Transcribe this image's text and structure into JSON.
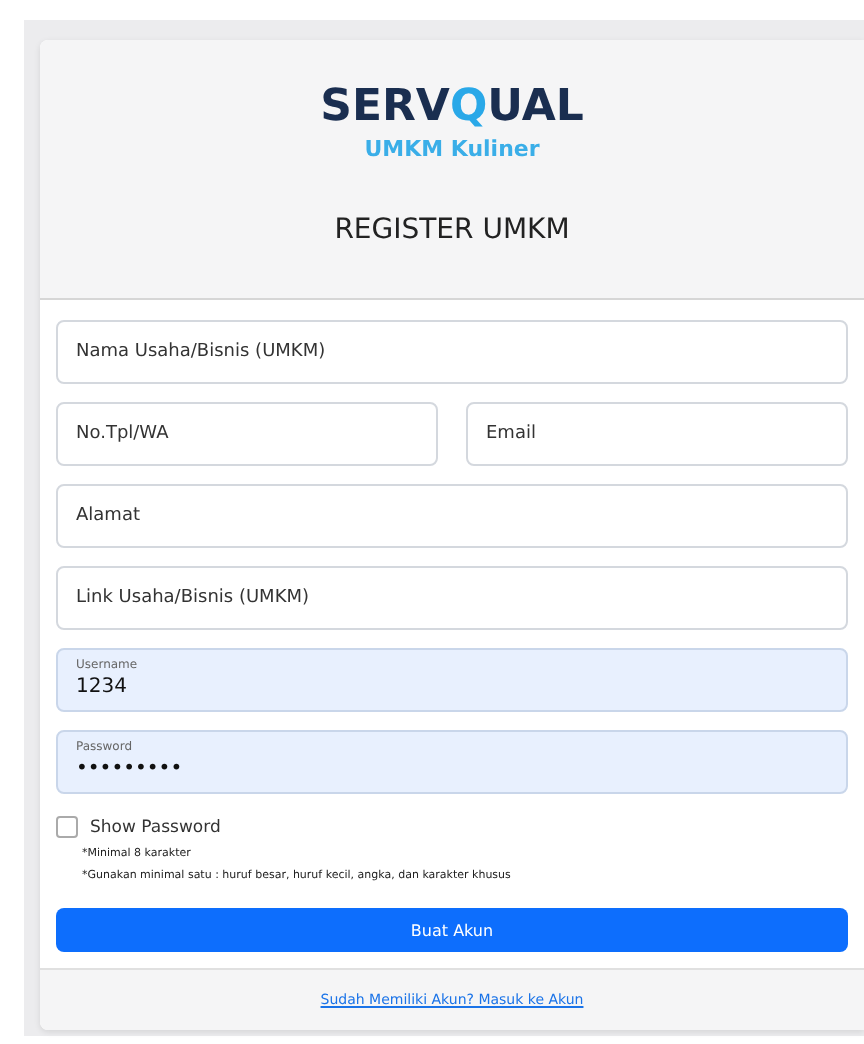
{
  "logo": {
    "prefix": "SERV",
    "accent": "Q",
    "suffix": "UAL",
    "subtitle": "UMKM Kuliner"
  },
  "title": "REGISTER UMKM",
  "fields": [
    {
      "kind": "plain",
      "placeholder": "Nama Usaha/Bisnis (UMKM)"
    },
    {
      "kind": "pair",
      "items": [
        {
          "placeholder": "No.Tpl/WA"
        },
        {
          "placeholder": "Email"
        }
      ]
    },
    {
      "kind": "plain",
      "placeholder": "Alamat"
    },
    {
      "kind": "plain",
      "placeholder": "Link Usaha/Bisnis (UMKM)"
    },
    {
      "kind": "floating",
      "label": "Username",
      "value": "1234"
    },
    {
      "kind": "floating",
      "label": "Password",
      "value": "•••••••••"
    }
  ],
  "show_password": {
    "label": "Show Password",
    "checked": false
  },
  "notes": [
    "*Minimal 8 karakter",
    "*Gunakan minimal satu : huruf besar, huruf kecil, angka, dan karakter khusus"
  ],
  "submit": "Buat Akun",
  "login_link": "Sudah Memiliki Akun? Masuk ke Akun"
}
